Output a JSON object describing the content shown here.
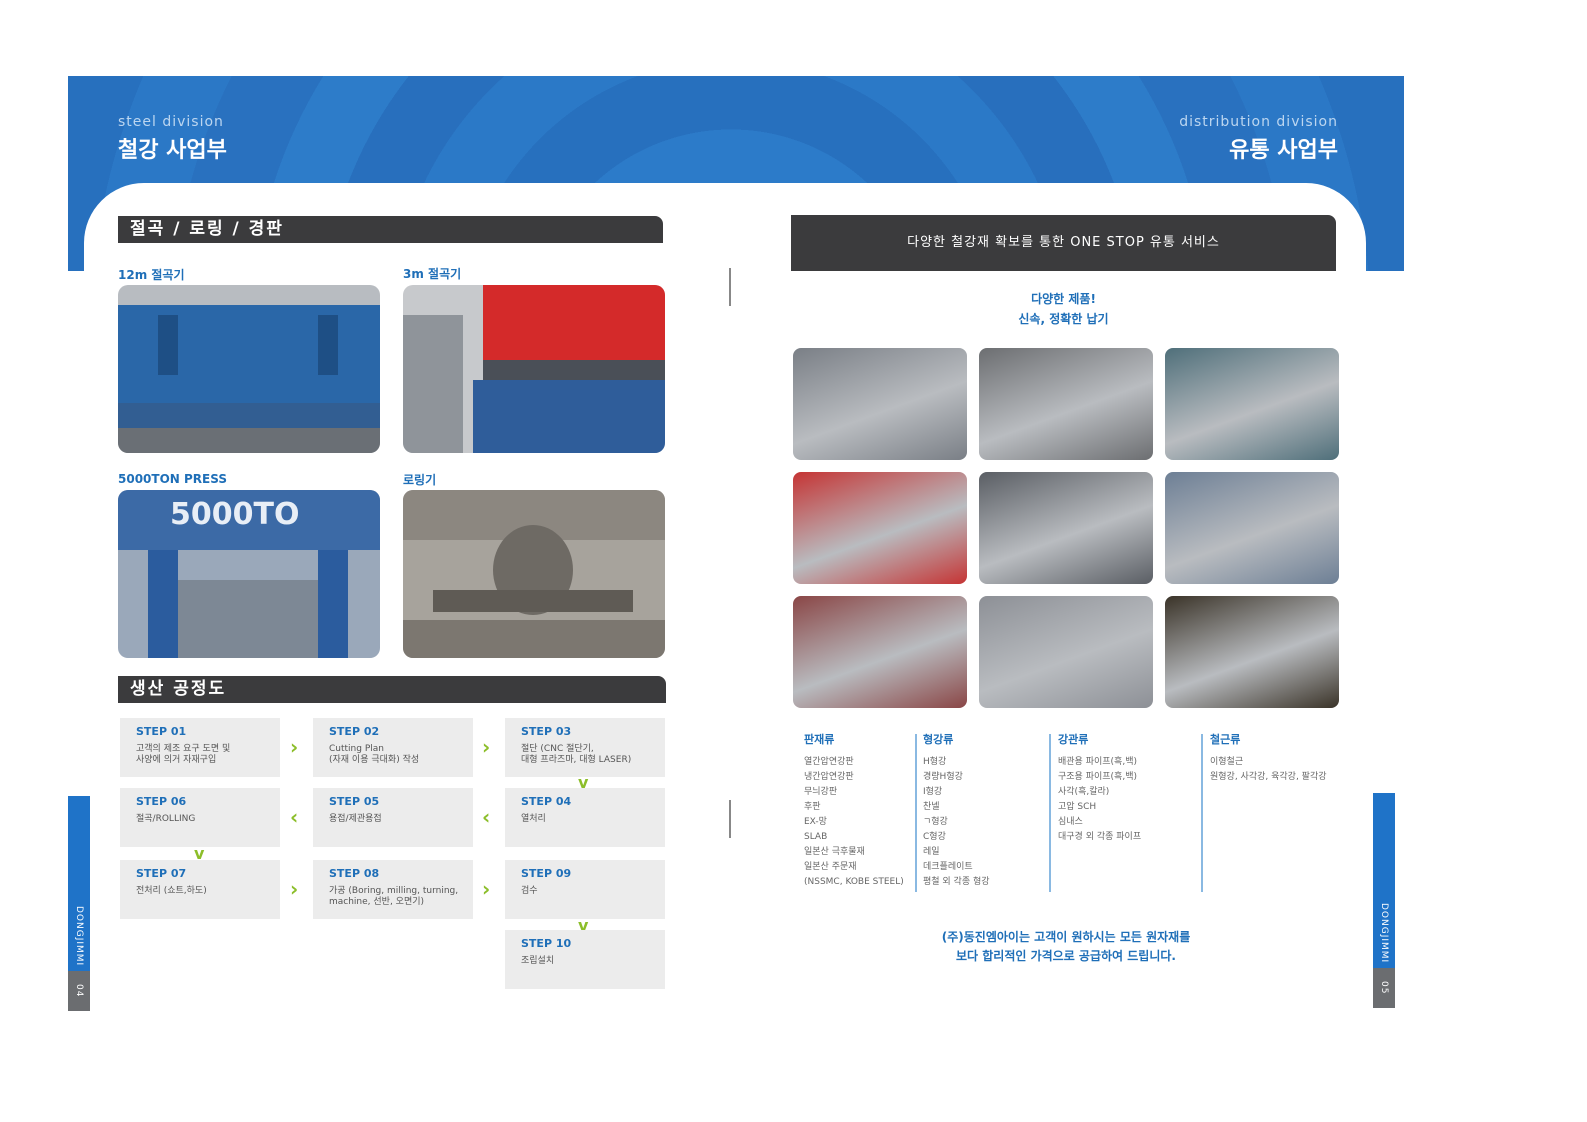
{
  "left_page": {
    "division_en": "steel division",
    "division_ko": "철강 사업부",
    "section1_title": "절곡 / 로링 / 경판",
    "photos": [
      {
        "label": "12m 절곡기",
        "color": "#2a67a8"
      },
      {
        "label": "3m 절곡기",
        "color": "#d42a2a"
      },
      {
        "label": "5000TON PRESS",
        "color": "#2b5c9e"
      },
      {
        "label": "로링기",
        "color": "#6e6a64"
      }
    ],
    "press_overlay_text": "5000TO",
    "section2_title": "생산 공정도",
    "steps": [
      {
        "title": "STEP 01",
        "desc": "고객의 제조 요구 도면 및\n사양에 의거 자재구입"
      },
      {
        "title": "STEP 02",
        "desc": "Cutting Plan\n(자재 이용 극대화) 작성"
      },
      {
        "title": "STEP 03",
        "desc": "절단 (CNC 절단기,\n대형 프라즈마, 대형 LASER)"
      },
      {
        "title": "STEP 04",
        "desc": "열처리"
      },
      {
        "title": "STEP 05",
        "desc": "용접/제관용접"
      },
      {
        "title": "STEP 06",
        "desc": "절곡/ROLLING"
      },
      {
        "title": "STEP 07",
        "desc": "전처리 (쇼트,하도)"
      },
      {
        "title": "STEP 08",
        "desc": "가공 (Boring, milling, turning,\nmachine, 선반, 오면기)"
      },
      {
        "title": "STEP 09",
        "desc": "검수"
      },
      {
        "title": "STEP 10",
        "desc": "조립설치"
      }
    ],
    "side_brand": "DONGJIMMI",
    "page_number": "04"
  },
  "right_page": {
    "division_en": "distribution division",
    "division_ko": "유통 사업부",
    "headline": "다양한 철강재 확보를 통한 ONE STOP 유통 서비스",
    "slogan_line1": "다양한 제품!",
    "slogan_line2": "신속, 정확한 납기",
    "product_photos": [
      {
        "name": "steel-plates",
        "color": "#7a7f86"
      },
      {
        "name": "thick-plates",
        "color": "#6c6e71"
      },
      {
        "name": "painted-plates",
        "color": "#4f6f7a"
      },
      {
        "name": "round-bars",
        "color": "#c53434"
      },
      {
        "name": "rack-bars",
        "color": "#5a5e64"
      },
      {
        "name": "stacked-bars",
        "color": "#6d7f95"
      },
      {
        "name": "tubes",
        "color": "#8a4646"
      },
      {
        "name": "h-beam",
        "color": "#8d9096"
      },
      {
        "name": "angles",
        "color": "#3a3328"
      }
    ],
    "categories": [
      {
        "title": "판재류",
        "items": [
          "열간압연강판",
          "냉간압연강판",
          "무늬강판",
          "후판",
          "EX-망",
          "SLAB",
          "일본산 극후물재",
          "일본산 주문재",
          "(NSSMC, KOBE STEEL)"
        ]
      },
      {
        "title": "형강류",
        "items": [
          "H형강",
          "경량H형강",
          "I형강",
          "찬넬",
          "ㄱ형강",
          "C형강",
          "레일",
          "데크플레이트",
          "평철 외 각종 형강"
        ]
      },
      {
        "title": "강관류",
        "items": [
          "배관용 파이프(흑,백)",
          "구조용 파이프(흑,백)",
          "사각(흑,칼라)",
          "고압 SCH",
          "심내스",
          "대구경 외 각종 파이프"
        ]
      },
      {
        "title": "철근류",
        "items": [
          "이형철근",
          "원형강, 사각강, 육각강, 팔각강"
        ]
      }
    ],
    "closing_line1": "(주)동진엠아이는 고객이 원하시는 모든 원자재를",
    "closing_line2": "보다 합리적인 가격으로 공급하여 드립니다.",
    "side_brand": "DONGJIMMI",
    "page_number": "05"
  },
  "colors": {
    "brand_blue": "#1f6fb8",
    "banner_blue": "#2a74c3",
    "bar_dark": "#3b3b3d",
    "arrow_green": "#8cbe2a"
  }
}
